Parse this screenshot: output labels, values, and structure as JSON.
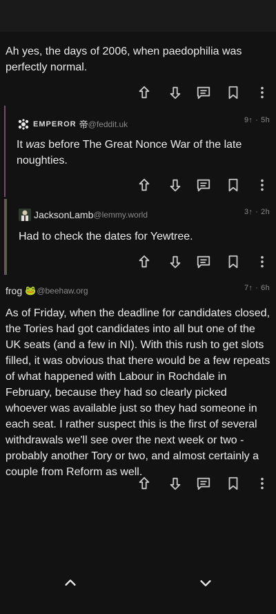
{
  "comments": [
    {
      "text": "Ah yes, the days of 2006, when paedophilia was perfectly normal."
    },
    {
      "user": "EMPEROR",
      "user_suffix": "帝",
      "instance": "@feddit.uk",
      "votes": "9↑",
      "age": "5h",
      "text_before": "It ",
      "text_em": "was",
      "text_after": " before The Great Nonce War of the late noughties."
    },
    {
      "user": "JacksonLamb",
      "instance": "@lemmy.world",
      "votes": "3↑",
      "age": "2h",
      "text": "Had to check the dates for Yewtree."
    },
    {
      "user": "frog",
      "user_emoji": "🐸",
      "instance": "@beehaw.org",
      "votes": "7↑",
      "age": "6h",
      "text": "As of Friday, when the deadline for candidates closed, the Tories had got candidates into all but one of the UK seats (and a few in NI). With this rush to get slots filled, it was obvious that there would be a few repeats of what happened with Labour in Rochdale in February, because they had so clearly picked whoever was available just so they had someone in each seat. I rather suspect this is the first of several withdrawals we'll see over the next week or two - probably another Tory or two, and almost certainly a couple from Reform as well."
    }
  ],
  "colors": {
    "background": "#121212",
    "rail_level2": "#7a4a6a",
    "rail_level3": "#4a6a3a",
    "icon": "#c8c8c8",
    "meta_gray": "#8a8a8a"
  },
  "icons": {
    "upvote": "arrow-up-icon",
    "downvote": "arrow-down-icon",
    "reply": "reply-icon",
    "save": "bookmark-icon",
    "more": "more-vertical-icon",
    "prev": "chevron-up-icon",
    "next": "chevron-down-icon"
  }
}
